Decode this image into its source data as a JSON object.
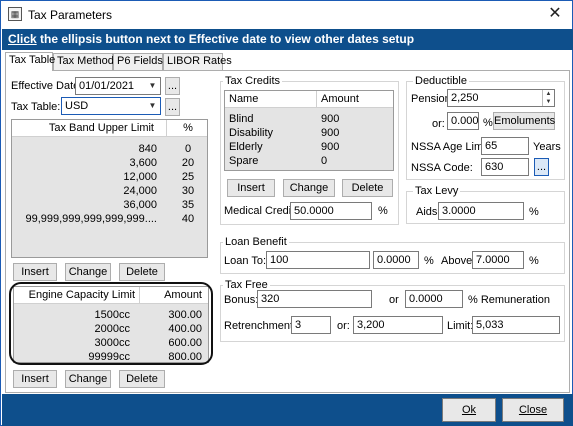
{
  "window": {
    "title": "Tax Parameters",
    "close_glyph": "✕",
    "icon_glyph": "▦"
  },
  "banner": {
    "click": "Click",
    "rest": " the ellipsis button next to Effective date to view other dates setup"
  },
  "tabs": [
    {
      "label": "Tax Table",
      "active": true
    },
    {
      "label": "Tax Method",
      "active": false
    },
    {
      "label": "P6 Fields",
      "active": false
    },
    {
      "label": "LIBOR Rates",
      "active": false
    }
  ],
  "effective_date": {
    "label": "Effective Date:",
    "value": "01/01/2021",
    "ellipsis": "..."
  },
  "tax_table": {
    "label": "Tax Table:",
    "value": "USD",
    "ellipsis": "..."
  },
  "tax_bands": {
    "headers": [
      "Tax Band Upper Limit",
      "%"
    ],
    "rows": [
      [
        "840",
        "0"
      ],
      [
        "3,600",
        "20"
      ],
      [
        "12,000",
        "25"
      ],
      [
        "24,000",
        "30"
      ],
      [
        "36,000",
        "35"
      ],
      [
        "99,999,999,999,999,999....",
        "40"
      ]
    ],
    "buttons": {
      "insert": "Insert",
      "change": "Change",
      "delete": "Delete"
    }
  },
  "engine": {
    "headers": [
      "Engine Capacity Limit",
      "Amount"
    ],
    "rows": [
      [
        "1500cc",
        "300.00"
      ],
      [
        "2000cc",
        "400.00"
      ],
      [
        "3000cc",
        "600.00"
      ],
      [
        "99999cc",
        "800.00"
      ]
    ],
    "buttons": {
      "insert": "Insert",
      "change": "Change",
      "delete": "Delete"
    }
  },
  "tax_credits": {
    "title": "Tax Credits",
    "headers": [
      "Name",
      "Amount"
    ],
    "rows": [
      [
        "Blind",
        "900"
      ],
      [
        "Disability",
        "900"
      ],
      [
        "Elderly",
        "900"
      ],
      [
        "Spare",
        "0"
      ]
    ],
    "buttons": {
      "insert": "Insert",
      "change": "Change",
      "delete": "Delete"
    },
    "medical_label": "Medical Credits:",
    "medical_value": "50.0000",
    "medical_unit": "%"
  },
  "deductible": {
    "title": "Deductible",
    "pension_label": "Pension:",
    "pension_value": "2,250",
    "or_label": "or:",
    "or_value": "0.0000",
    "or_unit": "%",
    "emoluments": "Emoluments",
    "nssa_age_label": "NSSA Age Limit:",
    "nssa_age_value": "65",
    "years": "Years",
    "nssa_code_label": "NSSA Code:",
    "nssa_code_value": "630",
    "nssa_ellipsis": "..."
  },
  "tax_levy": {
    "title": "Tax Levy",
    "aids_label": "Aids:",
    "aids_value": "3.0000",
    "unit": "%"
  },
  "loan_benefit": {
    "title": "Loan Benefit",
    "loan_to_label": "Loan To:",
    "loan_to_value": "100",
    "rate_value": "0.0000",
    "rate_unit": "%",
    "above_label": "Above:",
    "above_value": "7.0000",
    "above_unit": "%"
  },
  "tax_free": {
    "title": "Tax Free",
    "bonus_label": "Bonus:",
    "bonus_value": "320",
    "or_label": "or",
    "or_value": "0.0000",
    "remuneration_label": "% Remuneration",
    "retrenchment_label": "Retrenchment /",
    "retrenchment_value": "3",
    "or2_label": "or:",
    "or2_value": "3,200",
    "limit_label": "Limit:",
    "limit_value": "5,033"
  },
  "footer": {
    "ok": "Ok",
    "close": "Close"
  }
}
